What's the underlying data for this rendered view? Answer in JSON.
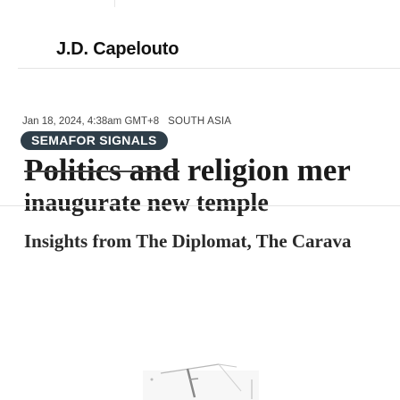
{
  "byline": {
    "author": "J.D. Capelouto"
  },
  "meta": {
    "date": "Jan 18, 2024, 4:38am GMT+8",
    "region": "SOUTH ASIA"
  },
  "category": {
    "label": "SEMAFOR SIGNALS"
  },
  "headline": {
    "struck_part": "Politics and",
    "rest_line1": " religion mer",
    "line2": "inaugurate new temple"
  },
  "subheadline": {
    "text": "Insights from The Diplomat, The Carava"
  },
  "figure": {
    "icon": "partial-image-icon"
  }
}
